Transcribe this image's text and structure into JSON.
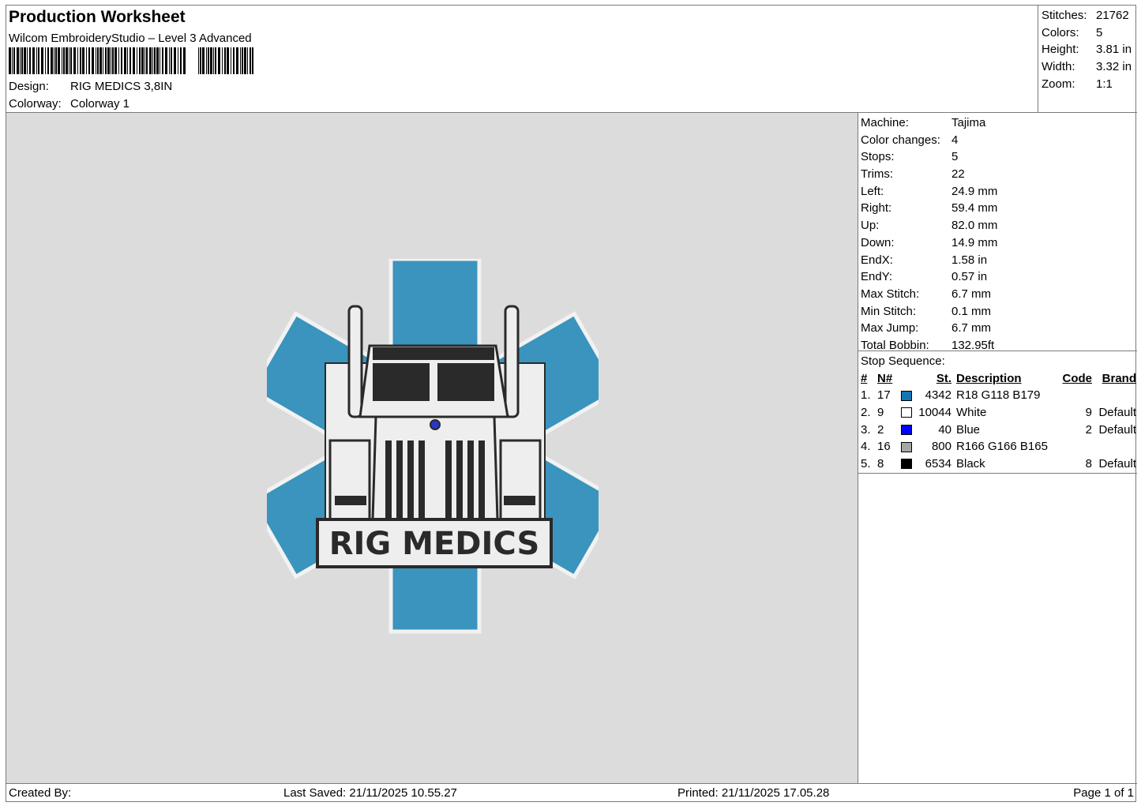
{
  "header": {
    "title": "Production Worksheet",
    "software": "Wilcom EmbroideryStudio – Level 3 Advanced",
    "design_label": "Design:",
    "design_value": "RIG MEDICS 3,8IN",
    "colorway_label": "Colorway:",
    "colorway_value": "Colorway 1"
  },
  "stats": [
    {
      "label": "Stitches:",
      "value": "21762"
    },
    {
      "label": "Colors:",
      "value": "5"
    },
    {
      "label": "Height:",
      "value": "3.81 in"
    },
    {
      "label": "Width:",
      "value": "3.32 in"
    },
    {
      "label": "Zoom:",
      "value": "1:1"
    }
  ],
  "machine": [
    {
      "label": "Machine:",
      "value": "Tajima"
    },
    {
      "label": "Color changes:",
      "value": "4"
    },
    {
      "label": "Stops:",
      "value": "5"
    },
    {
      "label": "Trims:",
      "value": "22"
    },
    {
      "label": "Left:",
      "value": "24.9 mm"
    },
    {
      "label": "Right:",
      "value": "59.4 mm"
    },
    {
      "label": "Up:",
      "value": "82.0 mm"
    },
    {
      "label": "Down:",
      "value": "14.9 mm"
    },
    {
      "label": "EndX:",
      "value": "1.58 in"
    },
    {
      "label": "EndY:",
      "value": "0.57 in"
    },
    {
      "label": "Max Stitch:",
      "value": "6.7 mm"
    },
    {
      "label": "Min Stitch:",
      "value": "0.1 mm"
    },
    {
      "label": "Max Jump:",
      "value": "6.7 mm"
    },
    {
      "label": "Total Bobbin:",
      "value": "132.95ft"
    }
  ],
  "stop_sequence": {
    "title": "Stop Sequence:",
    "headers": {
      "num": "#",
      "n": "N#",
      "st": "St.",
      "desc": "Description",
      "code": "Code",
      "brand": "Brand"
    },
    "rows": [
      {
        "num": "1.",
        "n": "17",
        "color": "#1276b3",
        "st": "4342",
        "desc": "R18 G118 B179",
        "code": "",
        "brand": ""
      },
      {
        "num": "2.",
        "n": "9",
        "color": "#ffffff",
        "st": "10044",
        "desc": "White",
        "code": "9",
        "brand": "Default"
      },
      {
        "num": "3.",
        "n": "2",
        "color": "#0000ff",
        "st": "40",
        "desc": "Blue",
        "code": "2",
        "brand": "Default"
      },
      {
        "num": "4.",
        "n": "16",
        "color": "#a6a6a5",
        "st": "800",
        "desc": "R166 G166 B165",
        "code": "",
        "brand": ""
      },
      {
        "num": "5.",
        "n": "8",
        "color": "#000000",
        "st": "6534",
        "desc": "Black",
        "code": "8",
        "brand": "Default"
      }
    ]
  },
  "design": {
    "text": "RIG MEDICS",
    "colors": {
      "star": "#3a94bd",
      "white": "#eeeeee",
      "black": "#2a2a2a",
      "grey": "#a6a6a5",
      "blue": "#2a36c8"
    }
  },
  "footer": {
    "created_by": "Created By:",
    "last_saved": "Last Saved: 21/11/2025 10.55.27",
    "printed": "Printed: 21/11/2025 17.05.28",
    "page": "Page 1 of 1"
  }
}
